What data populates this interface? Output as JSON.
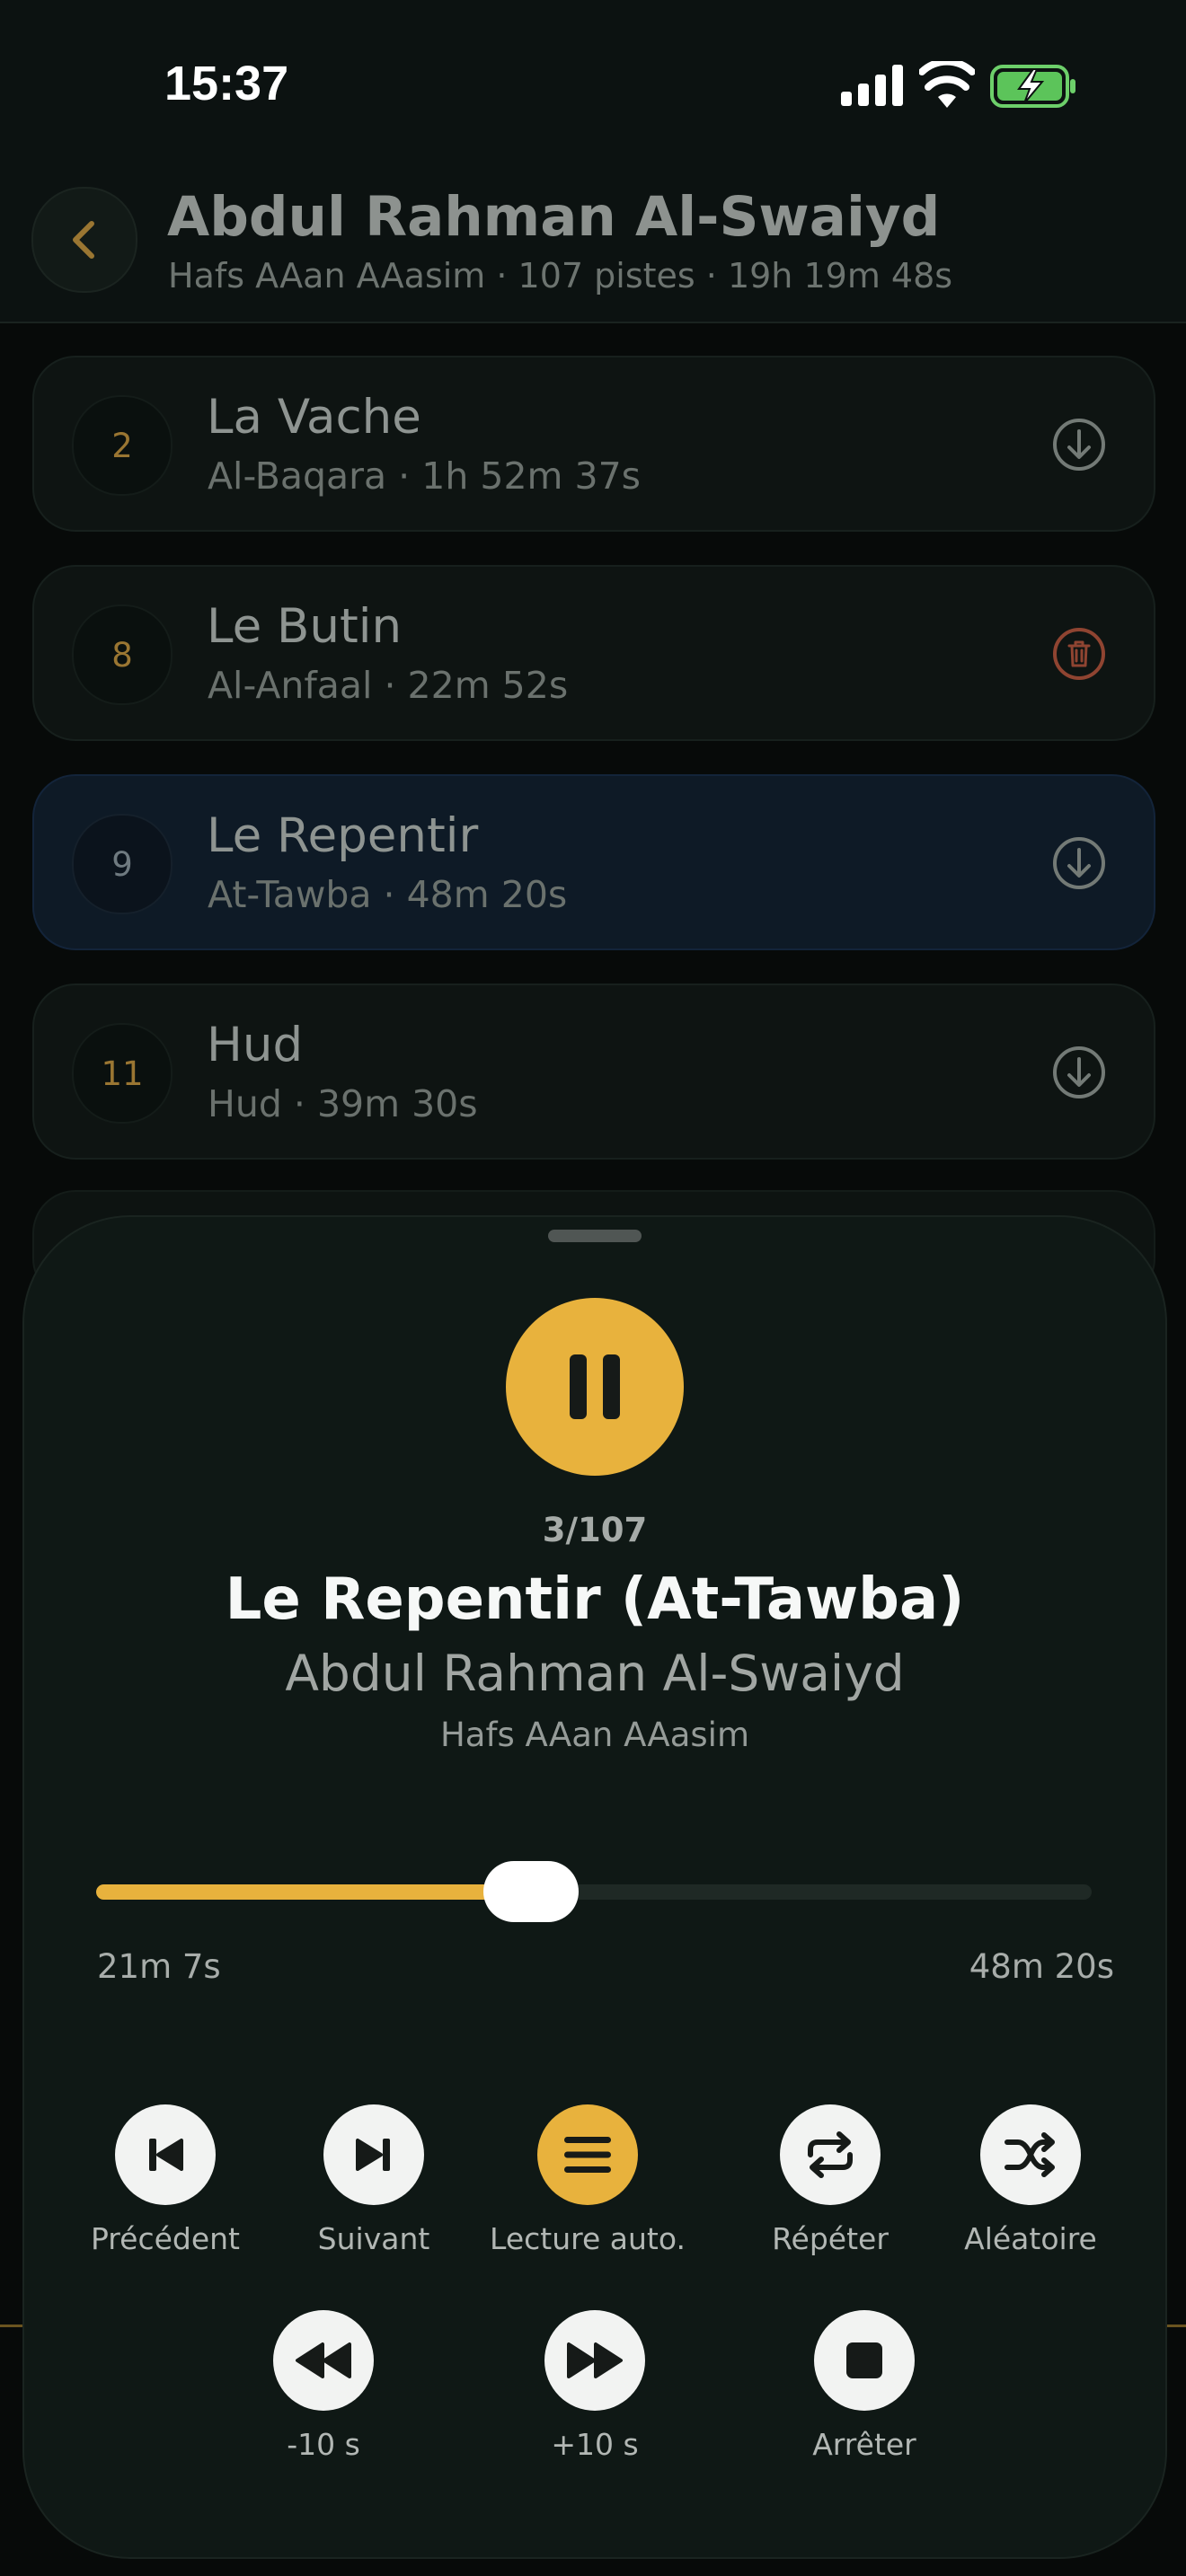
{
  "status_bar": {
    "time": "15:37"
  },
  "header": {
    "title": "Abdul Rahman Al-Swaiyd",
    "subtitle": "Hafs AAan AAasim · 107 pistes · 19h 19m 48s"
  },
  "tracks": [
    {
      "number": "2",
      "name": "La Vache",
      "meta": "Al-Baqara  ·  1h 52m 37s",
      "action": "download-icon",
      "active": false
    },
    {
      "number": "8",
      "name": "Le Butin",
      "meta": "Al-Anfaal  ·  22m 52s",
      "action": "trash-icon",
      "active": false
    },
    {
      "number": "9",
      "name": "Le Repentir",
      "meta": "At-Tawba  ·  48m 20s",
      "action": "download-icon",
      "active": true
    },
    {
      "number": "11",
      "name": "Hud",
      "meta": "Hud  ·  39m 30s",
      "action": "download-icon",
      "active": false
    }
  ],
  "player": {
    "position": "3/107",
    "title": "Le Repentir (At-Tawba)",
    "artist": "Abdul Rahman Al-Swaiyd",
    "narration": "Hafs AAan AAasim",
    "elapsed": "21m 7s",
    "duration": "48m 20s",
    "progress": 0.4372,
    "controls_row1": [
      {
        "label": "Précédent",
        "icon": "skip-previous-icon"
      },
      {
        "label": "Suivant",
        "icon": "skip-next-icon"
      },
      {
        "label": "Lecture auto.",
        "icon": "autoplay-list-icon",
        "active": true
      },
      {
        "label": "Répéter",
        "icon": "repeat-icon"
      },
      {
        "label": "Aléatoire",
        "icon": "shuffle-icon"
      }
    ],
    "controls_row2": [
      {
        "label": "-10 s",
        "icon": "rewind-icon"
      },
      {
        "label": "+10 s",
        "icon": "fast-forward-icon"
      },
      {
        "label": "Arrêter",
        "icon": "stop-icon"
      }
    ]
  },
  "colors": {
    "accent": "#e8b23d",
    "background": "#070a09",
    "sheet": "#0f1815",
    "danger": "#b4533b"
  }
}
